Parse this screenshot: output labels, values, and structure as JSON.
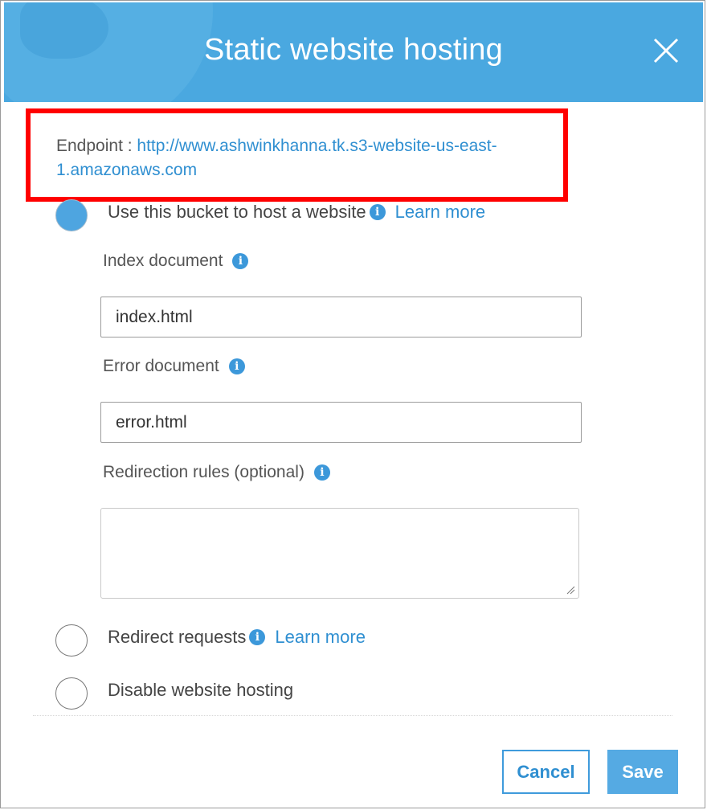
{
  "dialog": {
    "title": "Static website hosting"
  },
  "endpoint": {
    "label": "Endpoint :",
    "url_line1": "http://www.ashwinkhanna.tk.s3-website-us-east-",
    "url_line2": "1.amazonaws.com"
  },
  "options": {
    "host_website": {
      "label": "Use this bucket to host a website",
      "learn_more": "Learn more",
      "selected": true
    },
    "redirect": {
      "label": "Redirect requests",
      "learn_more": "Learn more",
      "selected": false
    },
    "disable": {
      "label": "Disable website hosting",
      "selected": false
    }
  },
  "fields": {
    "index_document": {
      "label": "Index document",
      "value": "index.html"
    },
    "error_document": {
      "label": "Error document",
      "value": "error.html"
    },
    "redirection_rules": {
      "label": "Redirection rules (optional)",
      "value": ""
    }
  },
  "buttons": {
    "cancel": "Cancel",
    "save": "Save"
  },
  "colors": {
    "header": "#4aa8e0",
    "link": "#2f8fd1",
    "highlight": "#ff0000",
    "primary_button": "#55aae3"
  }
}
